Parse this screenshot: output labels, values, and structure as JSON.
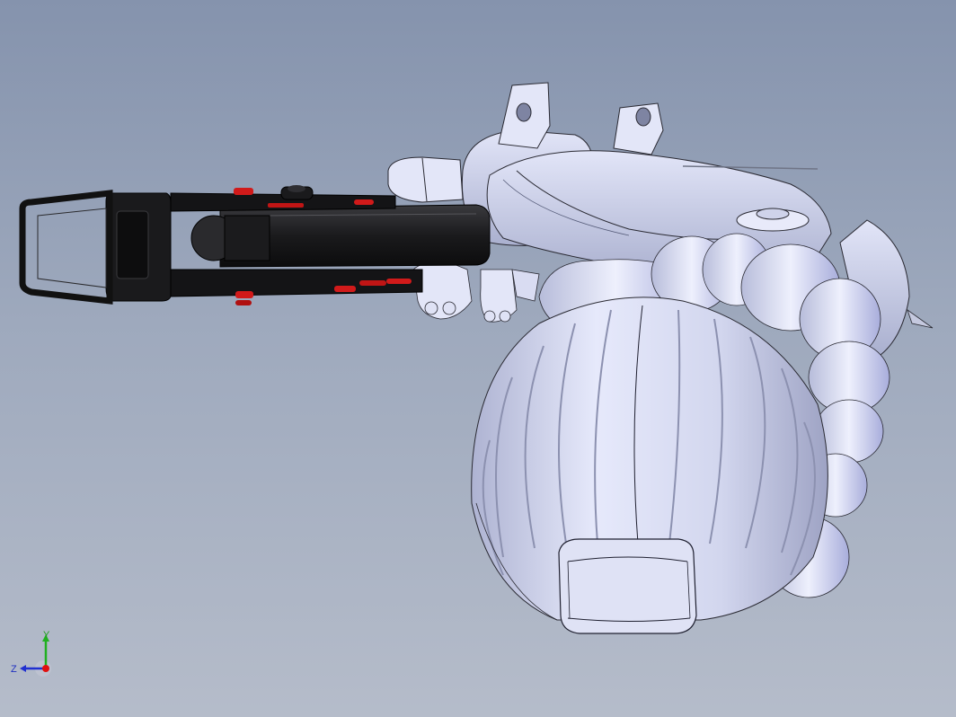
{
  "viewport": {
    "background_top": "#8593ad",
    "background_bottom": "#b5bcca"
  },
  "model": {
    "shell_color": "#d4d8ef",
    "shell_shade": "#a9aecb",
    "edge_color": "#2a2a33",
    "arm_color": "#1c1c1e",
    "accent_color": "#d11a1a"
  },
  "triad": {
    "x_label": "",
    "y_label": "Y",
    "z_label": "Z",
    "y_color": "#20b020",
    "z_color": "#2030d0",
    "x_color": "#e01010"
  }
}
